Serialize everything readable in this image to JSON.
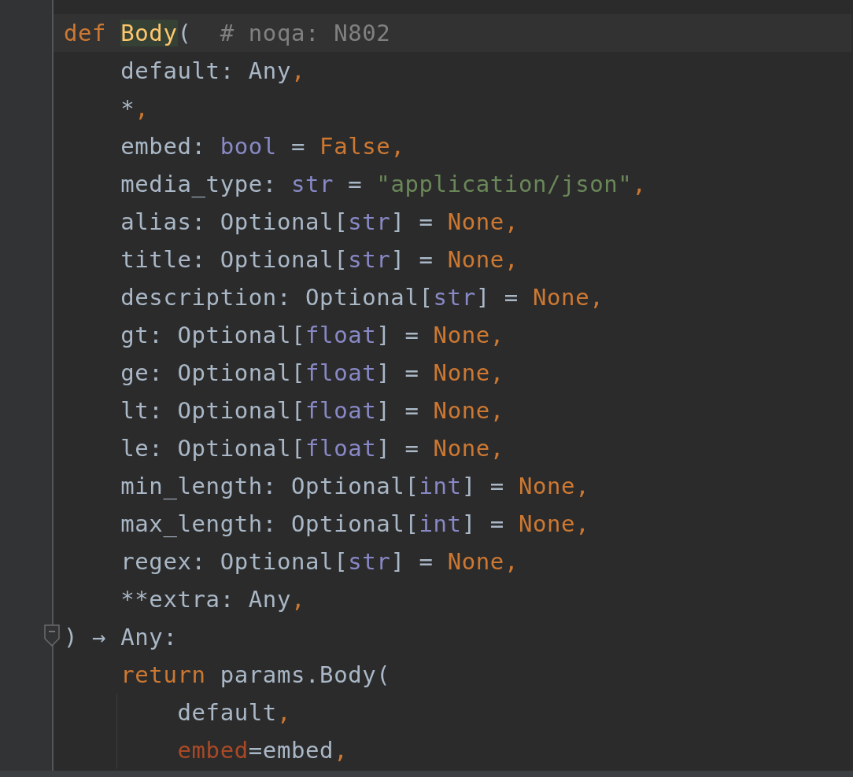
{
  "editor": {
    "lines": [
      {
        "current": true,
        "fold": false,
        "tokens": [
          {
            "kind": "keyword",
            "text": "def "
          },
          {
            "kind": "function",
            "text": "Body",
            "highlighted": true
          },
          {
            "kind": "plain",
            "text": "(  "
          },
          {
            "kind": "comment",
            "text": "# noqa: N802"
          }
        ]
      },
      {
        "current": false,
        "fold": false,
        "tokens": [
          {
            "kind": "plain",
            "text": "    default: Any"
          },
          {
            "kind": "punct",
            "text": ","
          }
        ]
      },
      {
        "current": false,
        "fold": false,
        "tokens": [
          {
            "kind": "plain",
            "text": "    *"
          },
          {
            "kind": "punct",
            "text": ","
          }
        ]
      },
      {
        "current": false,
        "fold": false,
        "tokens": [
          {
            "kind": "plain",
            "text": "    embed: "
          },
          {
            "kind": "builtin",
            "text": "bool"
          },
          {
            "kind": "plain",
            "text": " = "
          },
          {
            "kind": "keyword",
            "text": "False"
          },
          {
            "kind": "punct",
            "text": ","
          }
        ]
      },
      {
        "current": false,
        "fold": false,
        "tokens": [
          {
            "kind": "plain",
            "text": "    media_type: "
          },
          {
            "kind": "builtin",
            "text": "str"
          },
          {
            "kind": "plain",
            "text": " = "
          },
          {
            "kind": "string",
            "text": "\"application/json\""
          },
          {
            "kind": "punct",
            "text": ","
          }
        ]
      },
      {
        "current": false,
        "fold": false,
        "tokens": [
          {
            "kind": "plain",
            "text": "    alias: Optional["
          },
          {
            "kind": "builtin",
            "text": "str"
          },
          {
            "kind": "plain",
            "text": "] = "
          },
          {
            "kind": "keyword",
            "text": "None"
          },
          {
            "kind": "punct",
            "text": ","
          }
        ]
      },
      {
        "current": false,
        "fold": false,
        "tokens": [
          {
            "kind": "plain",
            "text": "    title: Optional["
          },
          {
            "kind": "builtin",
            "text": "str"
          },
          {
            "kind": "plain",
            "text": "] = "
          },
          {
            "kind": "keyword",
            "text": "None"
          },
          {
            "kind": "punct",
            "text": ","
          }
        ]
      },
      {
        "current": false,
        "fold": false,
        "tokens": [
          {
            "kind": "plain",
            "text": "    description: Optional["
          },
          {
            "kind": "builtin",
            "text": "str"
          },
          {
            "kind": "plain",
            "text": "] = "
          },
          {
            "kind": "keyword",
            "text": "None"
          },
          {
            "kind": "punct",
            "text": ","
          }
        ]
      },
      {
        "current": false,
        "fold": false,
        "tokens": [
          {
            "kind": "plain",
            "text": "    gt: Optional["
          },
          {
            "kind": "builtin",
            "text": "float"
          },
          {
            "kind": "plain",
            "text": "] = "
          },
          {
            "kind": "keyword",
            "text": "None"
          },
          {
            "kind": "punct",
            "text": ","
          }
        ]
      },
      {
        "current": false,
        "fold": false,
        "tokens": [
          {
            "kind": "plain",
            "text": "    ge: Optional["
          },
          {
            "kind": "builtin",
            "text": "float"
          },
          {
            "kind": "plain",
            "text": "] = "
          },
          {
            "kind": "keyword",
            "text": "None"
          },
          {
            "kind": "punct",
            "text": ","
          }
        ]
      },
      {
        "current": false,
        "fold": false,
        "tokens": [
          {
            "kind": "plain",
            "text": "    lt: Optional["
          },
          {
            "kind": "builtin",
            "text": "float"
          },
          {
            "kind": "plain",
            "text": "] = "
          },
          {
            "kind": "keyword",
            "text": "None"
          },
          {
            "kind": "punct",
            "text": ","
          }
        ]
      },
      {
        "current": false,
        "fold": false,
        "tokens": [
          {
            "kind": "plain",
            "text": "    le: Optional["
          },
          {
            "kind": "builtin",
            "text": "float"
          },
          {
            "kind": "plain",
            "text": "] = "
          },
          {
            "kind": "keyword",
            "text": "None"
          },
          {
            "kind": "punct",
            "text": ","
          }
        ]
      },
      {
        "current": false,
        "fold": false,
        "tokens": [
          {
            "kind": "plain",
            "text": "    min_length: Optional["
          },
          {
            "kind": "builtin",
            "text": "int"
          },
          {
            "kind": "plain",
            "text": "] = "
          },
          {
            "kind": "keyword",
            "text": "None"
          },
          {
            "kind": "punct",
            "text": ","
          }
        ]
      },
      {
        "current": false,
        "fold": false,
        "tokens": [
          {
            "kind": "plain",
            "text": "    max_length: Optional["
          },
          {
            "kind": "builtin",
            "text": "int"
          },
          {
            "kind": "plain",
            "text": "] = "
          },
          {
            "kind": "keyword",
            "text": "None"
          },
          {
            "kind": "punct",
            "text": ","
          }
        ]
      },
      {
        "current": false,
        "fold": false,
        "tokens": [
          {
            "kind": "plain",
            "text": "    regex: Optional["
          },
          {
            "kind": "builtin",
            "text": "str"
          },
          {
            "kind": "plain",
            "text": "] = "
          },
          {
            "kind": "keyword",
            "text": "None"
          },
          {
            "kind": "punct",
            "text": ","
          }
        ]
      },
      {
        "current": false,
        "fold": false,
        "tokens": [
          {
            "kind": "plain",
            "text": "    **extra: Any"
          },
          {
            "kind": "punct",
            "text": ","
          }
        ]
      },
      {
        "current": false,
        "fold": true,
        "tokens": [
          {
            "kind": "plain",
            "text": ") → Any:"
          }
        ]
      },
      {
        "current": false,
        "fold": false,
        "tokens": [
          {
            "kind": "keyword",
            "text": "    return"
          },
          {
            "kind": "plain",
            "text": " params.Body("
          }
        ]
      },
      {
        "current": false,
        "fold": false,
        "guide": true,
        "tokens": [
          {
            "kind": "plain",
            "text": "        default"
          },
          {
            "kind": "punct",
            "text": ","
          }
        ]
      },
      {
        "current": false,
        "fold": false,
        "guide": true,
        "tokens": [
          {
            "kind": "kwarg",
            "text": "        embed"
          },
          {
            "kind": "plain",
            "text": "=embed"
          },
          {
            "kind": "punct",
            "text": ","
          }
        ]
      }
    ]
  }
}
